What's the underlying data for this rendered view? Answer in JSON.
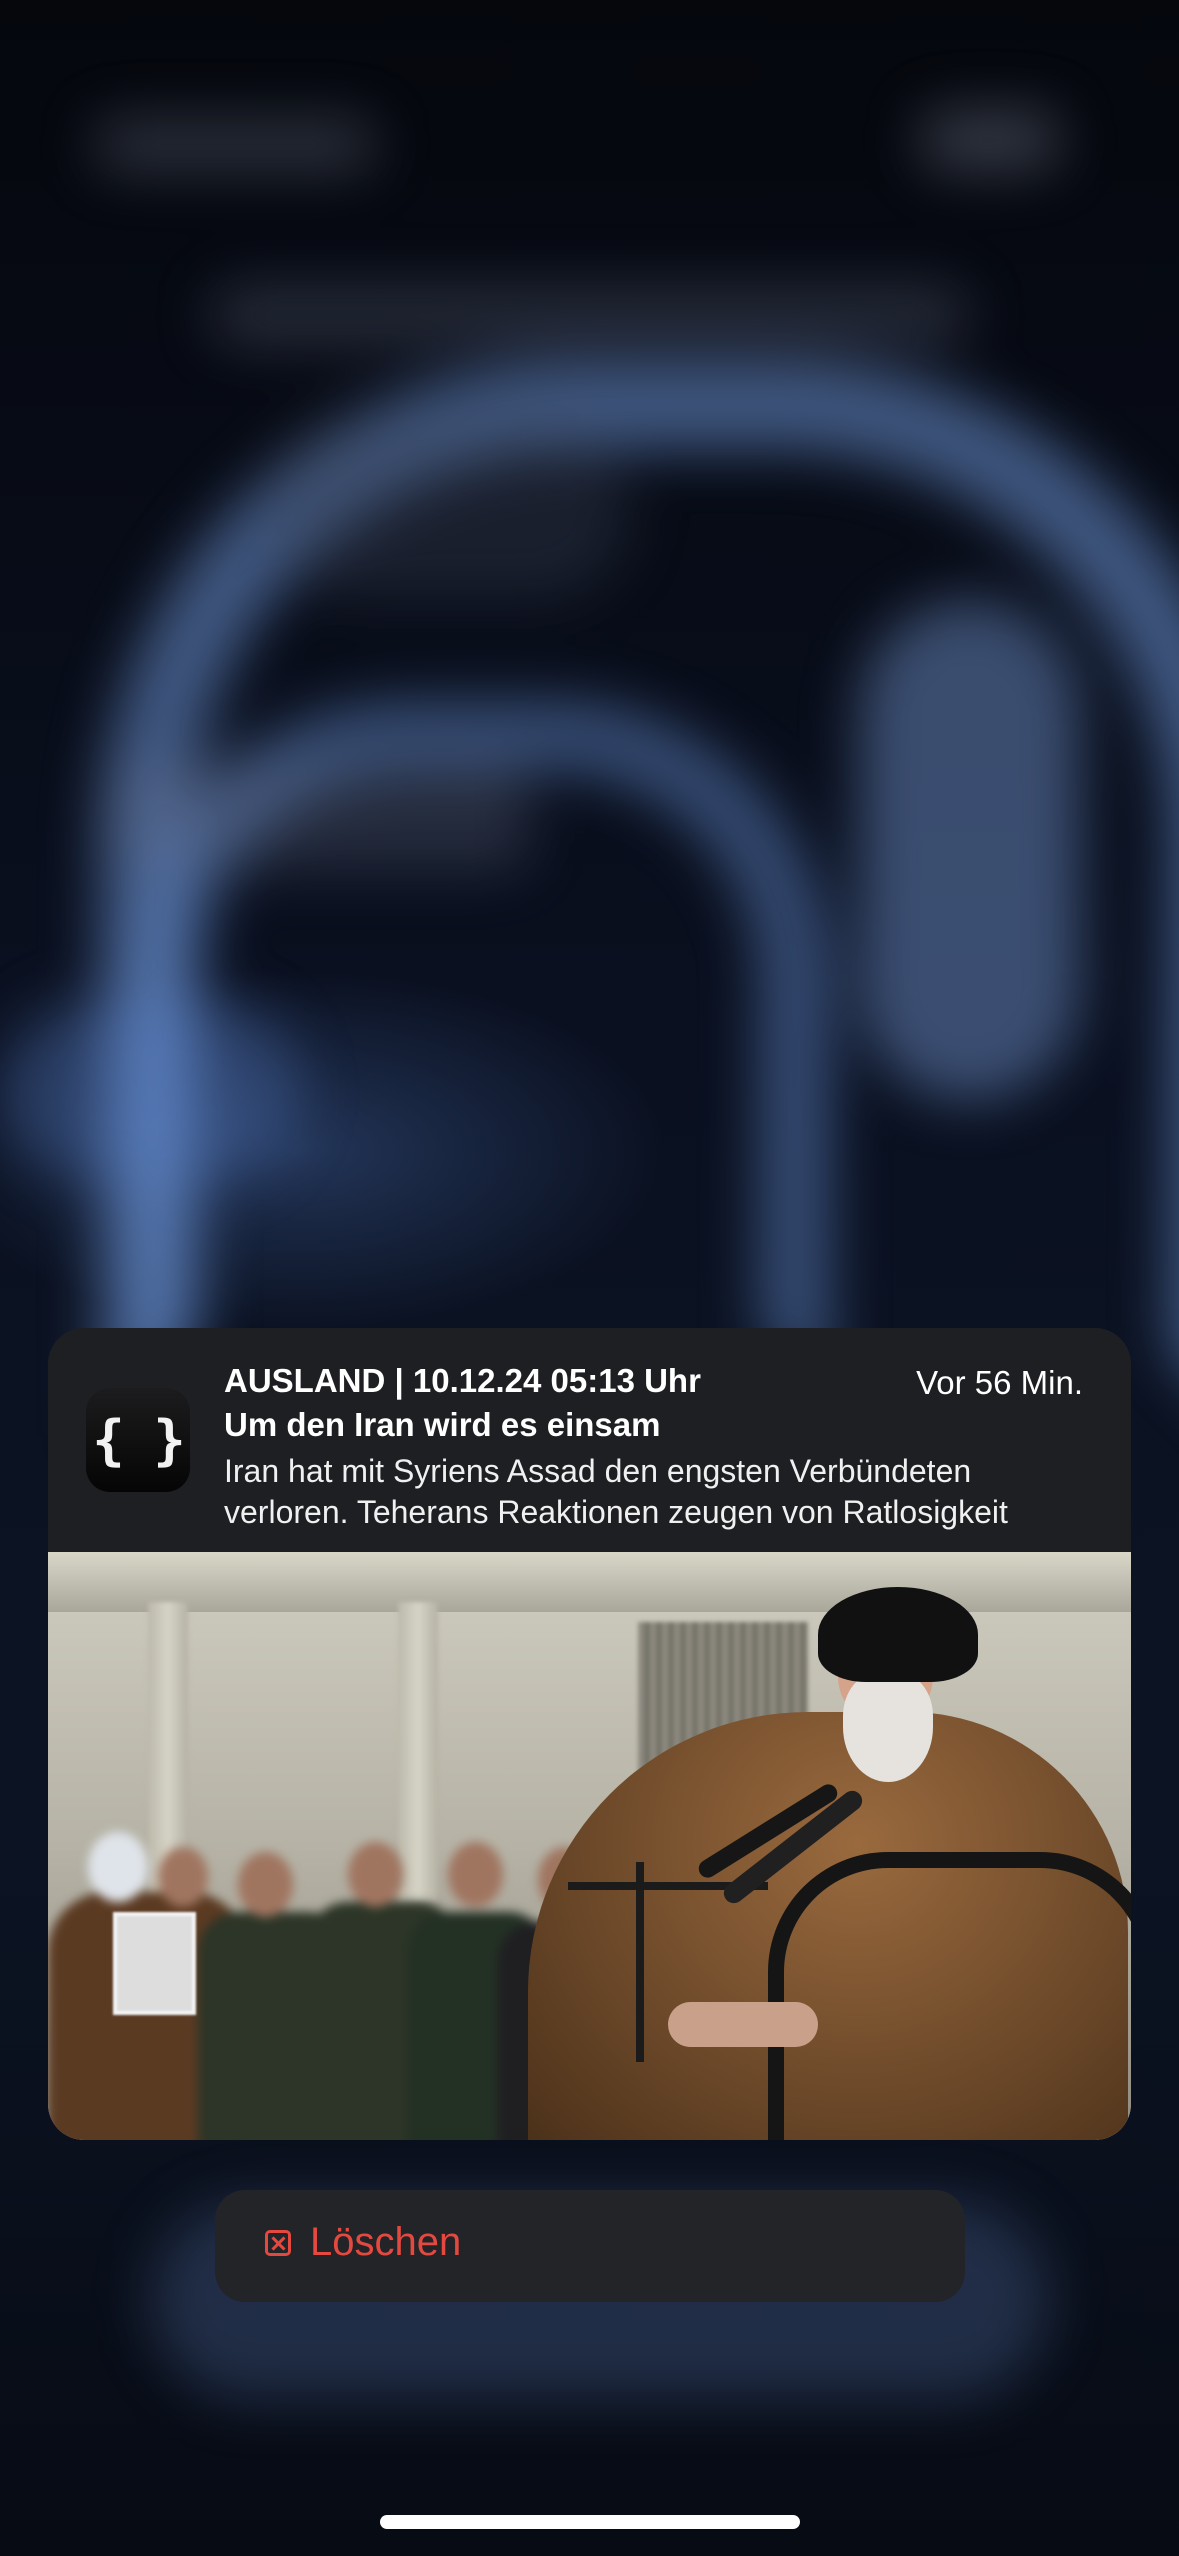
{
  "notification": {
    "app_icon_glyph": "{ }",
    "app_icon_name": "curly-braces-icon",
    "category": "AUSLAND | 10.12.24 05:13 Uhr",
    "time_ago": "Vor 56 Min.",
    "title": "Um den Iran wird es einsam",
    "body": "Iran hat mit Syriens Assad den engsten Verbündeten verloren. Teherans Reaktionen zeugen von Ratlosigkeit"
  },
  "actions": {
    "delete_label": "Löschen",
    "delete_icon": "x-square-icon",
    "delete_color": "#e5483f"
  },
  "colors": {
    "notification_background": "#1e1f22",
    "action_background": "#232428"
  }
}
